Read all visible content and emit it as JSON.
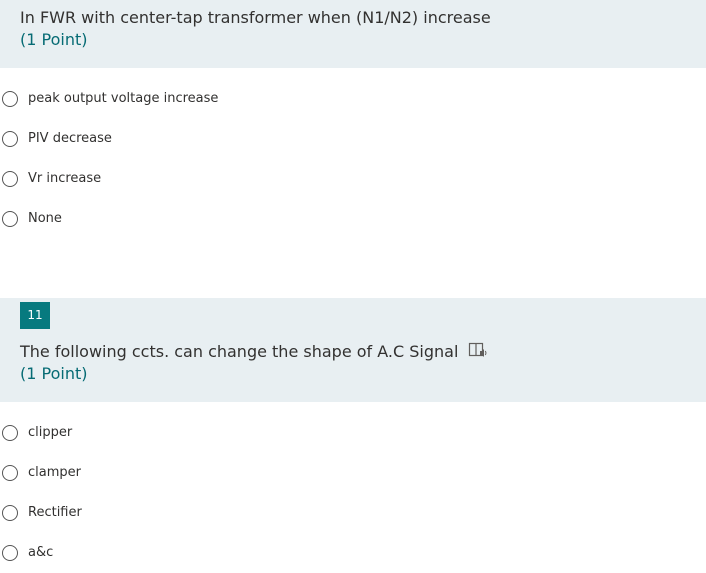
{
  "questions": [
    {
      "number": "",
      "title": "In FWR with center-tap transformer when (N1/N2) increase",
      "points": "(1 Point)",
      "options": [
        "peak output voltage increase",
        "PIV decrease",
        "Vr increase",
        "None"
      ]
    },
    {
      "number": "11",
      "title": "The following ccts. can change the shape of A.C Signal",
      "points": "(1 Point)",
      "icon": "immersive-reader-icon",
      "options": [
        "clipper",
        "clamper",
        "Rectifier",
        "a&c"
      ]
    }
  ],
  "colors": {
    "header_bg": "#e8eff2",
    "accent": "#077a7f",
    "points_text": "#066b74"
  }
}
